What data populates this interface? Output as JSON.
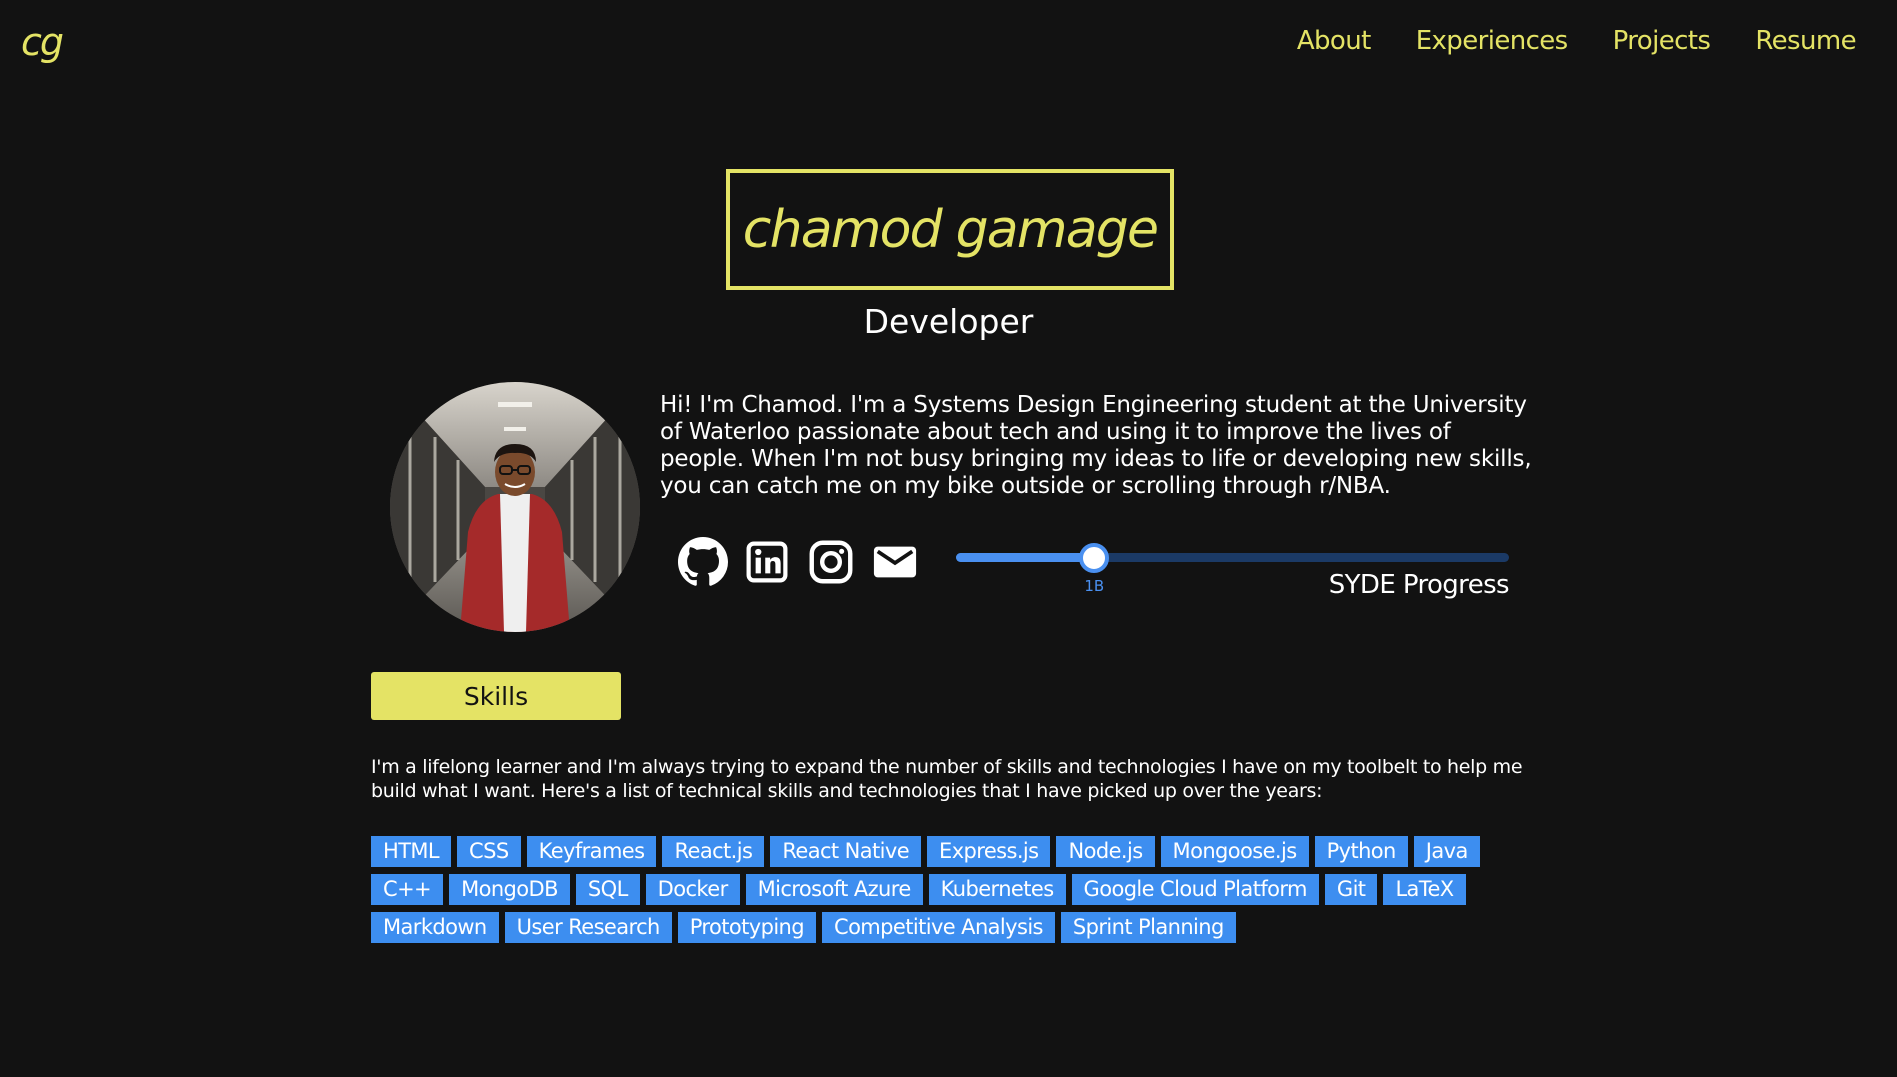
{
  "header": {
    "logo": "cg",
    "nav": [
      "About",
      "Experiences",
      "Projects",
      "Resume"
    ]
  },
  "hero": {
    "name": "chamod gamage",
    "role": "Developer"
  },
  "about": {
    "bio": "Hi! I'm Chamod. I'm a Systems Design Engineering student at the University of Waterloo passionate about tech and using it to improve the lives of people. When I'm not busy bringing my ideas to life or developing new skills, you can catch me on my bike outside or scrolling through r/NBA.",
    "socials": [
      "github-icon",
      "linkedin-icon",
      "instagram-icon",
      "mail-icon"
    ],
    "progress": {
      "label": "SYDE Progress",
      "value_label": "1B",
      "fraction": 0.25
    }
  },
  "skills": {
    "button_label": "Skills",
    "description": "I'm a lifelong learner and I'm always trying to expand the number of skills and technologies I have on my toolbelt to help me build what I want. Here's a list of technical skills and technologies that I have picked up over the years:",
    "tags": [
      "HTML",
      "CSS",
      "Keyframes",
      "React.js",
      "React Native",
      "Express.js",
      "Node.js",
      "Mongoose.js",
      "Python",
      "Java",
      "C++",
      "MongoDB",
      "SQL",
      "Docker",
      "Microsoft Azure",
      "Kubernetes",
      "Google Cloud Platform",
      "Git",
      "LaTeX",
      "Markdown",
      "User Research",
      "Prototyping",
      "Competitive Analysis",
      "Sprint Planning"
    ]
  },
  "colors": {
    "background": "#121212",
    "accent": "#e4e365",
    "tag": "#3d8ef0",
    "slider": "#4a90f0"
  }
}
